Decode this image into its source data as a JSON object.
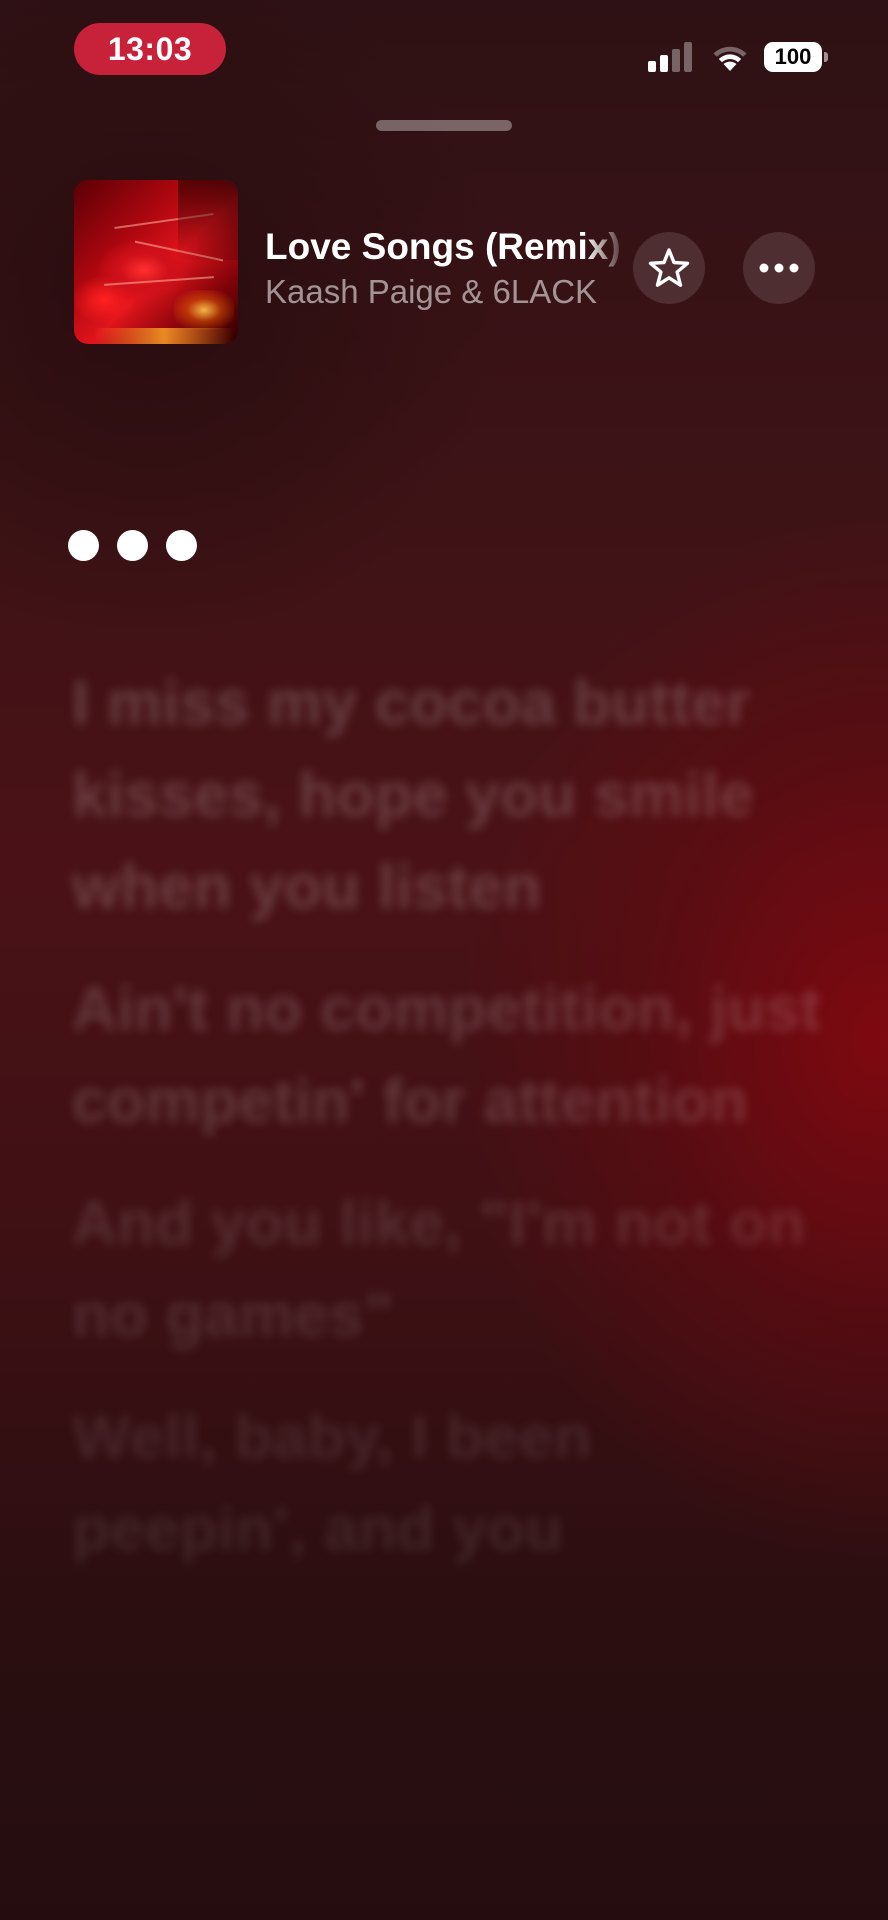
{
  "status_bar": {
    "time": "13:03",
    "battery_level": "100",
    "signal_icon": "cellular-signal-icon",
    "wifi_icon": "wifi-icon",
    "battery_icon": "battery-icon",
    "time_pill_color": "#c8213a"
  },
  "now_playing": {
    "title": "Love Songs (Remix)",
    "artist": "Kaash Paige & 6LACK",
    "favorite_icon": "star-icon",
    "more_icon": "ellipsis-icon"
  },
  "lyrics": {
    "waiting_indicator": "three-dots-icon",
    "lines": [
      "I miss my cocoa butter kisses, hope you smile when you listen",
      "Ain't no competition, just competin' for attention",
      "And you like, \"I'm not on no games\"",
      "Well, baby, I been peepin', and you"
    ]
  },
  "theme": {
    "background_base": "#3a1114",
    "accent_red": "#8c0a12"
  }
}
